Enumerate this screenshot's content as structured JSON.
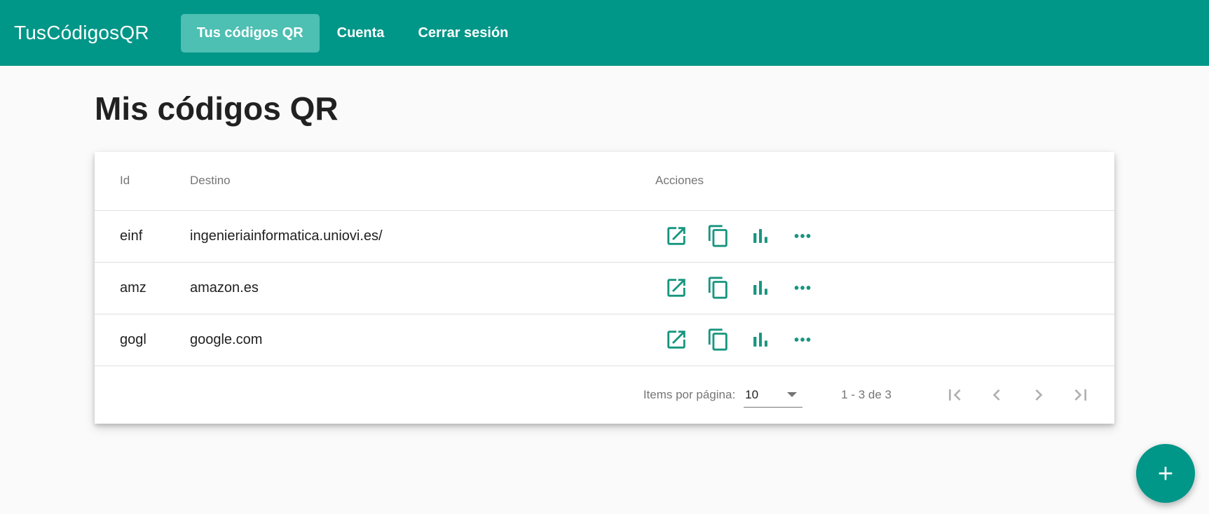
{
  "app": {
    "brand": "TusCódigosQR"
  },
  "nav": {
    "items": [
      {
        "label": "Tus códigos QR",
        "active": true
      },
      {
        "label": "Cuenta",
        "active": false
      },
      {
        "label": "Cerrar sesión",
        "active": false
      }
    ]
  },
  "page": {
    "title": "Mis códigos QR"
  },
  "table": {
    "headers": {
      "id": "Id",
      "destino": "Destino",
      "acciones": "Acciones"
    },
    "rows": [
      {
        "id": "einf",
        "destino": "ingenieriainformatica.uniovi.es/"
      },
      {
        "id": "amz",
        "destino": "amazon.es"
      },
      {
        "id": "gogl",
        "destino": "google.com"
      }
    ],
    "row_actions": [
      "open-in-new-icon",
      "copy-icon",
      "bar-chart-icon",
      "more-horiz-icon"
    ]
  },
  "paginator": {
    "items_label": "Items por página:",
    "page_size": "10",
    "range": "1 - 3 de 3"
  },
  "fab": {
    "icon": "add-icon"
  },
  "colors": {
    "primary": "#009688",
    "active_nav": "#4dbfb3",
    "icon": "#17957f"
  }
}
